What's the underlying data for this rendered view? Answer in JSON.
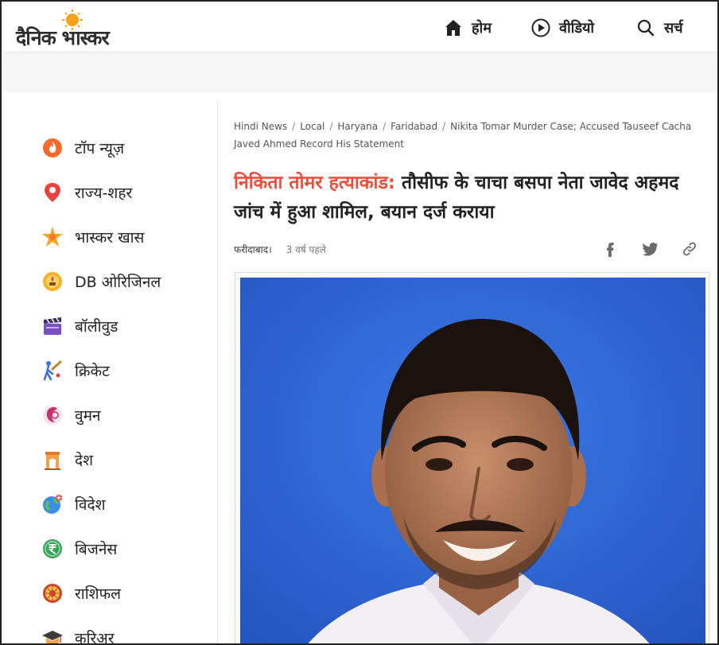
{
  "header": {
    "logo_text": "दैनिक भास्कर",
    "nav": [
      {
        "label": "होम",
        "icon": "home-icon"
      },
      {
        "label": "वीडियो",
        "icon": "play-circle-icon"
      },
      {
        "label": "सर्च",
        "icon": "search-icon"
      }
    ]
  },
  "sidebar": {
    "items": [
      {
        "label": "टॉप न्यूज़",
        "icon": "fire-icon"
      },
      {
        "label": "राज्य-शहर",
        "icon": "location-pin-icon"
      },
      {
        "label": "भास्कर खास",
        "icon": "star-burst-icon"
      },
      {
        "label": "DB ओरिजिनल",
        "icon": "lamp-icon"
      },
      {
        "label": "बॉलीवुड",
        "icon": "clapperboard-icon"
      },
      {
        "label": "क्रिकेट",
        "icon": "cricket-icon"
      },
      {
        "label": "वुमन",
        "icon": "woman-icon"
      },
      {
        "label": "देश",
        "icon": "india-gate-icon"
      },
      {
        "label": "विदेश",
        "icon": "globe-icon"
      },
      {
        "label": "बिजनेस",
        "icon": "rupee-icon"
      },
      {
        "label": "राशिफल",
        "icon": "zodiac-icon"
      },
      {
        "label": "करिअर",
        "icon": "graduation-cap-icon"
      }
    ]
  },
  "article": {
    "breadcrumb": [
      "Hindi News",
      "Local",
      "Haryana",
      "Faridabad",
      "Nikita Tomar Murder Case; Accused Tauseef Cacha Javed Ahmed Record His Statement"
    ],
    "headline_highlight": "निकिता तोमर हत्याकांड:",
    "headline_rest": " तौसीफ के चाचा बसपा नेता जावेद अहमद जांच में हुआ शामिल, बयान दर्ज कराया",
    "location": "फरीदाबाद।",
    "time": "3 वर्ष पहले"
  },
  "colors": {
    "accent": "#f04c3c",
    "photo_bg": "#2f67d6",
    "logo_sun": "#f7a21b"
  }
}
